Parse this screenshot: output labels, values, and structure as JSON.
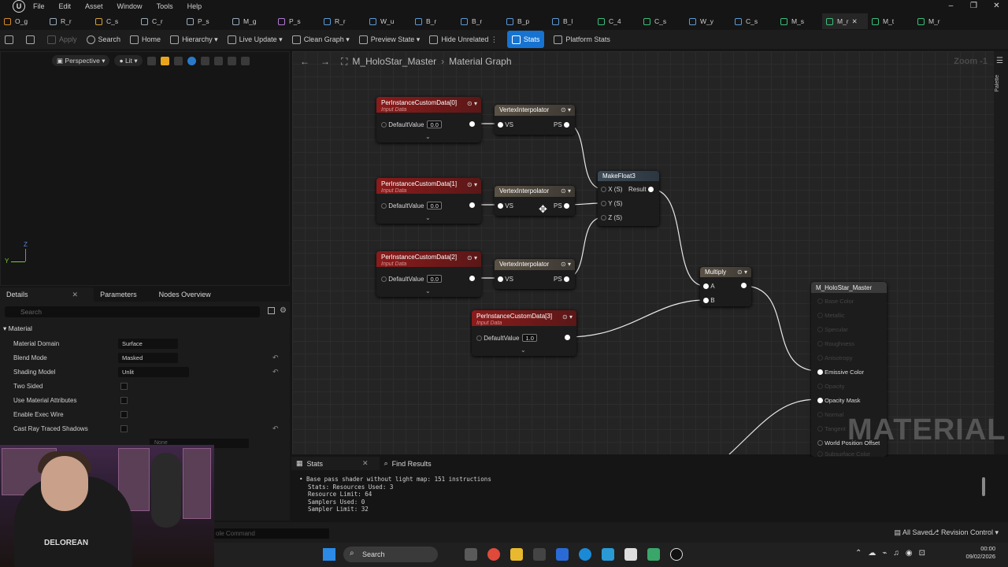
{
  "menu": {
    "items": [
      "File",
      "Edit",
      "Asset",
      "Window",
      "Tools",
      "Help"
    ]
  },
  "tabs": [
    {
      "label": "O_g",
      "color": "#d68a2a"
    },
    {
      "label": "R_r",
      "color": "#9ab"
    },
    {
      "label": "C_s",
      "color": "#d6a23a"
    },
    {
      "label": "C_r",
      "color": "#9ab"
    },
    {
      "label": "P_s",
      "color": "#9ab"
    },
    {
      "label": "M_g",
      "color": "#9ab"
    },
    {
      "label": "P_s",
      "color": "#b07ad6"
    },
    {
      "label": "R_r",
      "color": "#5a9ad6"
    },
    {
      "label": "W_u",
      "color": "#5a9ad6"
    },
    {
      "label": "B_r",
      "color": "#5a9ad6"
    },
    {
      "label": "B_r",
      "color": "#5a9ad6"
    },
    {
      "label": "B_p",
      "color": "#5a9ad6"
    },
    {
      "label": "B_l",
      "color": "#5a9ad6"
    },
    {
      "label": "C_4",
      "color": "#3ac07a"
    },
    {
      "label": "C_s",
      "color": "#3ac07a"
    },
    {
      "label": "W_y",
      "color": "#5a9ad6"
    },
    {
      "label": "C_s",
      "color": "#5a9ad6"
    },
    {
      "label": "M_s",
      "color": "#3ac07a"
    },
    {
      "label": "M_r",
      "color": "#3ac07a",
      "active": true
    },
    {
      "label": "M_t",
      "color": "#3ac07a"
    },
    {
      "label": "M_r",
      "color": "#3ac07a"
    }
  ],
  "toolbar": {
    "apply": "Apply",
    "search": "Search",
    "home": "Home",
    "hierarchy": "Hierarchy",
    "live_update": "Live Update",
    "clean_graph": "Clean Graph",
    "preview_state": "Preview State",
    "hide_unrelated": "Hide Unrelated",
    "stats": "Stats",
    "platform_stats": "Platform Stats"
  },
  "viewport": {
    "perspective": "Perspective",
    "lit": "Lit",
    "axis_z": "Z",
    "axis_y": "Y"
  },
  "details": {
    "tabs": [
      "Details",
      "Parameters",
      "Nodes Overview"
    ],
    "search_placeholder": "Search",
    "section": "Material",
    "props": [
      {
        "label": "Material Domain",
        "value": "Surface"
      },
      {
        "label": "Blend Mode",
        "value": "Masked"
      },
      {
        "label": "Shading Model",
        "value": "Unlit"
      },
      {
        "label": "Two Sided"
      },
      {
        "label": "Use Material Attributes"
      },
      {
        "label": "Enable Exec Wire"
      },
      {
        "label": "Cast Ray Traced Shadows"
      }
    ],
    "none_value": "None"
  },
  "graph": {
    "asset": "M_HoloStar_Master",
    "section": "Material Graph",
    "zoom": "Zoom -1",
    "palette": "Palette",
    "watermark": "MATERIAL",
    "nodes": {
      "pic0": {
        "title": "PerInstanceCustomData[0]",
        "sub": "Input Data",
        "pin": "DefaultValue",
        "val": "0.0"
      },
      "pic1": {
        "title": "PerInstanceCustomData[1]",
        "sub": "Input Data",
        "pin": "DefaultValue",
        "val": "0.0"
      },
      "pic2": {
        "title": "PerInstanceCustomData[2]",
        "sub": "Input Data",
        "pin": "DefaultValue",
        "val": "0.0"
      },
      "pic3": {
        "title": "PerInstanceCustomData[3]",
        "sub": "Input Data",
        "pin": "DefaultValue",
        "val": "1.0"
      },
      "vi": {
        "title": "VertexInterpolator",
        "vs": "VS",
        "ps": "PS"
      },
      "mf3": {
        "title": "MakeFloat3",
        "x": "X (S)",
        "y": "Y (S)",
        "z": "Z (S)",
        "result": "Result"
      },
      "mul": {
        "title": "Multiply",
        "a": "A",
        "b": "B"
      },
      "out": {
        "title": "M_HoloStar_Master",
        "pins": [
          "Base Color",
          "Metallic",
          "Specular",
          "Roughness",
          "Anisotropy",
          "Emissive Color",
          "Opacity",
          "Opacity Mask",
          "Normal",
          "Tangent",
          "World Position Offset",
          "Subsurface Color"
        ]
      }
    }
  },
  "bottom": {
    "tabs": [
      "Stats",
      "Find Results"
    ],
    "lines": [
      "Base pass shader without light map: 151 instructions",
      "Stats: Resources Used: 3",
      "Resource Limit: 64",
      "Samplers Used: 0",
      "Sampler Limit: 32"
    ]
  },
  "statusbar": {
    "cmd": "ole Command",
    "saved": "All Saved",
    "revision": "Revision Control"
  },
  "taskbar": {
    "search": "Search",
    "time": "00:00",
    "date": "09/02/2026"
  },
  "webcam": {
    "shirt": "DELOREAN"
  }
}
